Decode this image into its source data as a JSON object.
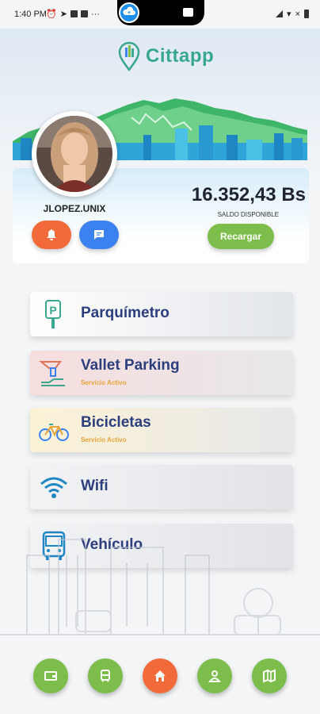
{
  "status_bar": {
    "time": "1:40 PM"
  },
  "header": {
    "app_name": "Cittapp"
  },
  "profile": {
    "username": "JLOPEZ.UNIX",
    "balance": "16.352,43 Bs",
    "balance_label": "SALDO DISPONIBLE",
    "recharge_label": "Recargar"
  },
  "services": [
    {
      "label": "Parquímetro",
      "subtitle": "",
      "icon": "parking-meter-icon"
    },
    {
      "label": "Vallet Parking",
      "subtitle": "Servicio Activo",
      "icon": "valet-icon"
    },
    {
      "label": "Bicicletas",
      "subtitle": "Servicio Activo",
      "icon": "bicycle-icon"
    },
    {
      "label": "Wifi",
      "subtitle": "",
      "icon": "wifi-icon"
    },
    {
      "label": "Vehículo",
      "subtitle": "",
      "icon": "bus-icon"
    }
  ],
  "colors": {
    "brand": "#3aa78f",
    "service_text": "#2d3e7c",
    "active_text": "#e8a43a",
    "green": "#7dbd4b",
    "orange": "#f26a3a",
    "blue": "#3b82f0"
  },
  "bottom_nav": [
    "wallet-icon",
    "transport-icon",
    "home-icon",
    "profile-icon",
    "map-icon"
  ]
}
